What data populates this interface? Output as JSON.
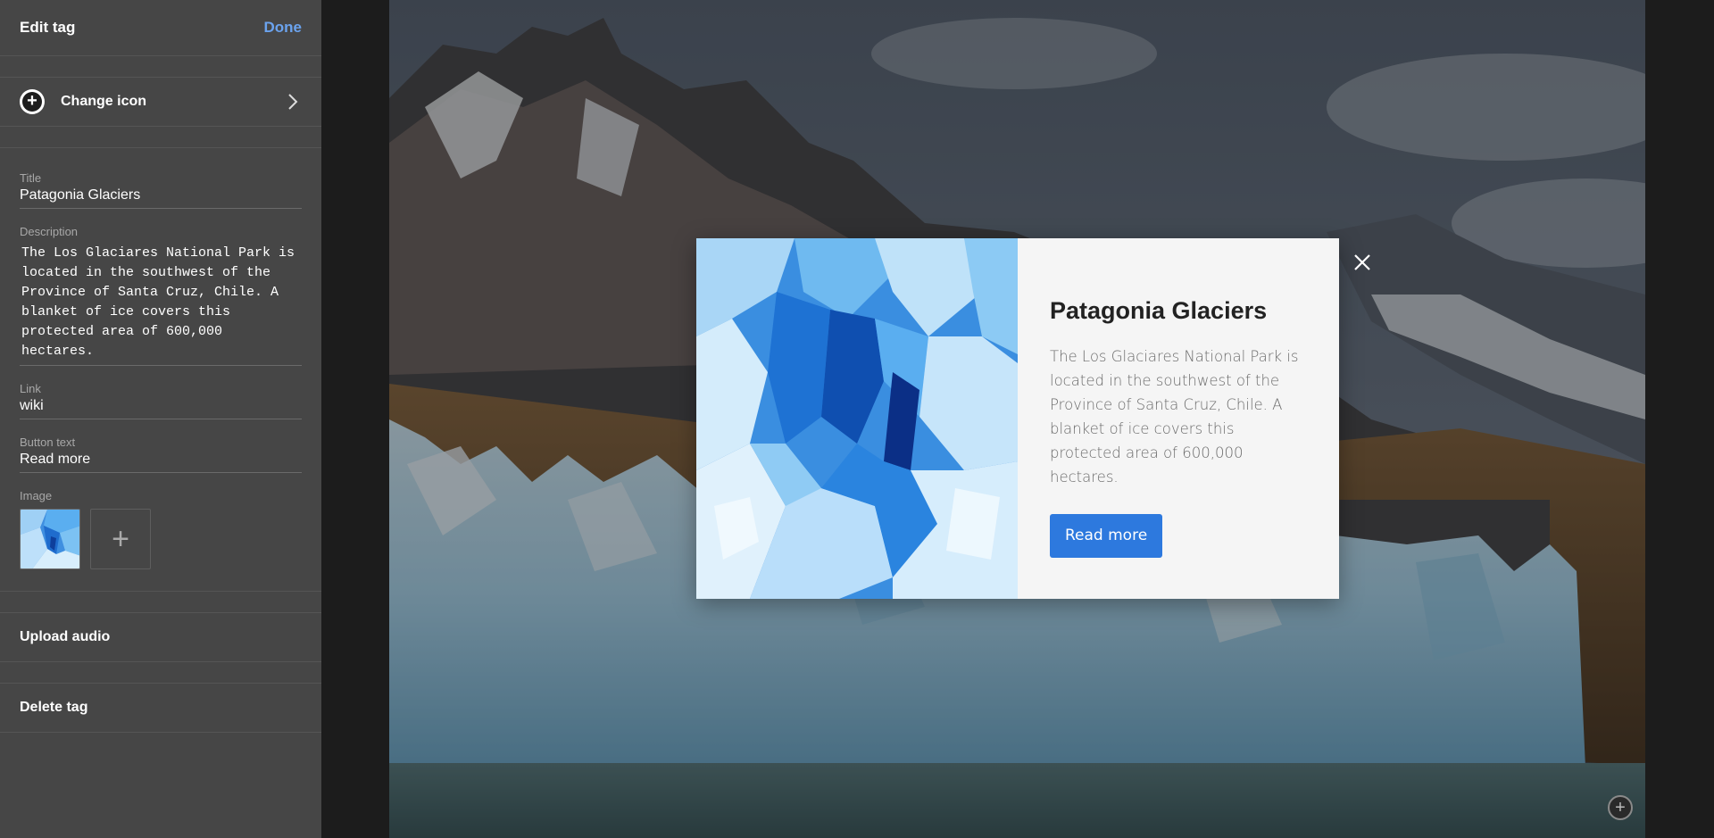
{
  "sidebar": {
    "header": {
      "title": "Edit tag",
      "done_label": "Done"
    },
    "change_icon_label": "Change icon",
    "fields": {
      "title": {
        "label": "Title",
        "value": "Patagonia Glaciers"
      },
      "description": {
        "label": "Description",
        "value": "The Los Glaciares National Park is\nlocated in the southwest of the\nProvince of Santa Cruz, Chile. A\nblanket of ice covers this\nprotected area of 600,000 hectares."
      },
      "link": {
        "label": "Link",
        "value": "wiki"
      },
      "button_text": {
        "label": "Button text",
        "value": "Read more"
      },
      "image": {
        "label": "Image",
        "add_glyph": "+"
      }
    },
    "upload_audio_label": "Upload audio",
    "delete_tag_label": "Delete tag"
  },
  "modal": {
    "title": "Patagonia Glaciers",
    "description": "The Los Glaciares National Park is located in the southwest of the Province of Santa Cruz, Chile. A blanket of ice covers this protected area of 600,000 hectares.",
    "button_label": "Read more"
  },
  "icons": {
    "change_icon": "plus-circle-icon",
    "chevron": "chevron-right-icon",
    "close": "close-icon",
    "corner": "add-tag-icon"
  },
  "colors": {
    "sidebar_bg": "#464646",
    "accent_link": "#6ba3ee",
    "button_blue": "#2d79de",
    "modal_bg": "#f5f5f5"
  }
}
